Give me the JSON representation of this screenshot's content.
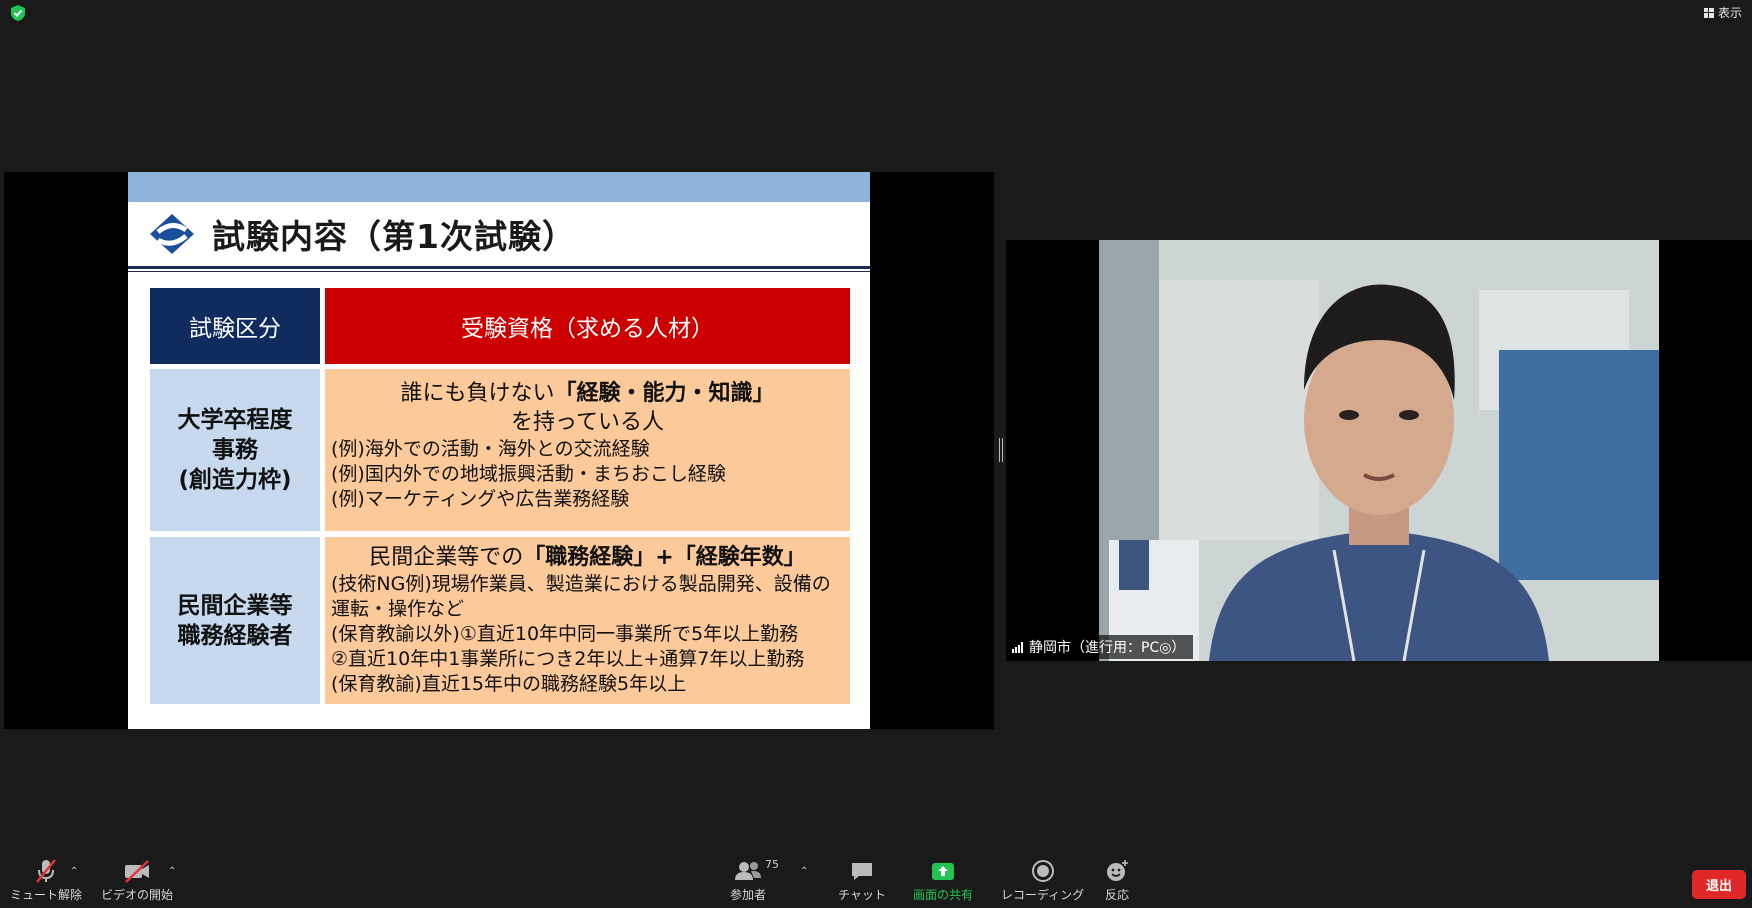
{
  "top": {
    "view_label": "表示"
  },
  "slide": {
    "title": "試験内容（第1次試験）",
    "table": {
      "header_left": "試験区分",
      "header_right": "受験資格（求める人材）",
      "rows": [
        {
          "category_lines": [
            "大学卒程度",
            "事務",
            "(創造力枠)"
          ],
          "lead_prefix": "誰にも負けない",
          "lead_bold": "「経験・能力・知識」",
          "lead_line2": "を持っている人",
          "examples": [
            "(例)海外での活動・海外との交流経験",
            "(例)国内外での地域振興活動・まちおこし経験",
            "(例)マーケティングや広告業務経験"
          ]
        },
        {
          "category_lines": [
            "民間企業等",
            "職務経験者"
          ],
          "lead_prefix": "民間企業等での",
          "lead_bold": "「職務経験」+「経験年数」",
          "examples": [
            "(技術NG例)現場作業員、製造業における製品開発、設備の",
            "運転・操作など",
            "(保育教諭以外)①直近10年中同一事業所で5年以上勤務",
            "②直近10年中1事業所につき2年以上+通算7年以上勤務",
            "(保育教諭)直近15年中の職務経験5年以上"
          ]
        }
      ]
    }
  },
  "video": {
    "participant_name": "静岡市（進行用：PC◎）"
  },
  "toolbar": {
    "mute_label": "ミュート解除",
    "video_label": "ビデオの開始",
    "participants_label": "参加者",
    "participants_count": "75",
    "chat_label": "チャット",
    "share_label": "画面の共有",
    "record_label": "レコーディング",
    "reactions_label": "反応",
    "leave_label": "退出"
  },
  "colors": {
    "header_navy": "#102c5f",
    "header_red": "#cc0000",
    "category_blue": "#c6d9ef",
    "content_peach": "#fcc99a",
    "share_green": "#23c552",
    "leave_red": "#e02828"
  }
}
